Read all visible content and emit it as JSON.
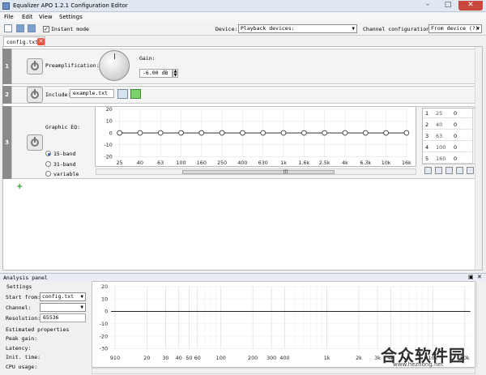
{
  "window": {
    "title": "Equalizer APO 1.2.1 Configuration Editor",
    "controls": {
      "minimize": "–",
      "maximize": "□",
      "close": "✕"
    }
  },
  "menu": [
    "File",
    "Edit",
    "View",
    "Settings"
  ],
  "toolbar": {
    "instant_mode_label": "Instant mode",
    "instant_mode_checked": true,
    "device_label": "Device:",
    "device_value": "Playback devices:",
    "channel_config_label": "Channel configuration:",
    "channel_config_value": "From device (?)"
  },
  "tabs": [
    {
      "label": "config.txt",
      "close": "✕"
    }
  ],
  "filters": [
    {
      "index": "1",
      "preamp_label": "Preamplification:",
      "gain_label": "Gain:",
      "gain_value": "-6.00 dB"
    },
    {
      "index": "2",
      "include_label": "Include:",
      "include_value": "example.txt"
    },
    {
      "index": "3",
      "graphic_eq_label": "Graphic EQ:",
      "band_options": [
        {
          "label": "15-band",
          "selected": true
        },
        {
          "label": "31-band",
          "selected": false
        },
        {
          "label": "variable",
          "selected": false
        }
      ],
      "y_ticks": [
        "20",
        "10",
        "0",
        "-10",
        "-20"
      ],
      "x_ticks": [
        "25",
        "40",
        "63",
        "100",
        "160",
        "250",
        "400",
        "630",
        "1k",
        "1.6k",
        "2.5k",
        "4k",
        "6.3k",
        "10k",
        "16k"
      ],
      "bands": [
        {
          "n": "1",
          "freq": "25",
          "gain": "0"
        },
        {
          "n": "2",
          "freq": "40",
          "gain": "0"
        },
        {
          "n": "3",
          "freq": "63",
          "gain": "0"
        },
        {
          "n": "4",
          "freq": "100",
          "gain": "0"
        },
        {
          "n": "5",
          "freq": "160",
          "gain": "0"
        }
      ]
    }
  ],
  "analysis": {
    "panel_title": "Analysis panel",
    "settings_title": "Settings",
    "start_from_label": "Start from:",
    "start_from_value": "config.txt",
    "channel_label": "Channel:",
    "channel_value": "",
    "resolution_label": "Resolution:",
    "resolution_value": "65536",
    "estimated_title": "Estimated properties",
    "peak_gain_label": "Peak gain:",
    "latency_label": "Latency:",
    "init_time_label": "Init. time:",
    "cpu_usage_label": "CPU usage:",
    "y_ticks": [
      "20",
      "10",
      "0",
      "-10",
      "-20",
      "-30"
    ],
    "x_ticks": [
      "910",
      "20",
      "30",
      "40",
      "50",
      "60",
      "100",
      "200",
      "300",
      "400",
      "1k",
      "2k",
      "3k",
      "4k",
      "10k",
      "20k"
    ]
  },
  "watermark": {
    "cn": "合众软件园",
    "url": "www.hezhong.net"
  }
}
